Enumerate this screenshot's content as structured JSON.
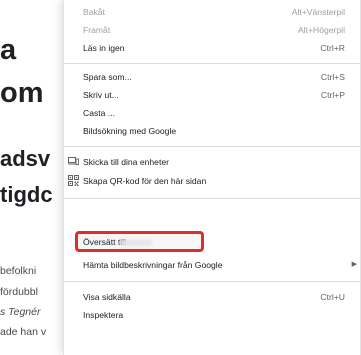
{
  "page": {
    "heading_line1": "a",
    "heading_line2": "om",
    "subheading_line1": "adsv",
    "subheading_line2": "tigdc",
    "body_lines": [
      "befolkni",
      "fördubbl",
      "s Tegnér",
      "ade han v"
    ]
  },
  "context_menu": {
    "items": [
      {
        "label": "Bakåt",
        "shortcut": "Alt+Vänsterpil"
      },
      {
        "label": "Framåt",
        "shortcut": "Alt+Högerpil"
      },
      {
        "label": "Läs in igen",
        "shortcut": "Ctrl+R"
      },
      {
        "label": "Spara som...",
        "shortcut": "Ctrl+S"
      },
      {
        "label": "Skriv ut...",
        "shortcut": "Ctrl+P"
      },
      {
        "label": "Casta ..."
      },
      {
        "label": "Bildsökning med Google"
      },
      {
        "label": "Skicka till dina enheter",
        "icon": "devices-icon"
      },
      {
        "label": "Skapa QR-kod för den här sidan",
        "icon": "qr-code-icon"
      },
      {
        "label": "Översätt till"
      },
      {
        "label": "Hämta bildbeskrivningar från Google"
      },
      {
        "label": "Visa sidkälla",
        "shortcut": "Ctrl+U"
      },
      {
        "label": "Inspektera"
      }
    ]
  },
  "colors": {
    "highlight_border": "#d9302a",
    "separator": "#dadce0",
    "disabled_text": "#9aa0a6"
  }
}
